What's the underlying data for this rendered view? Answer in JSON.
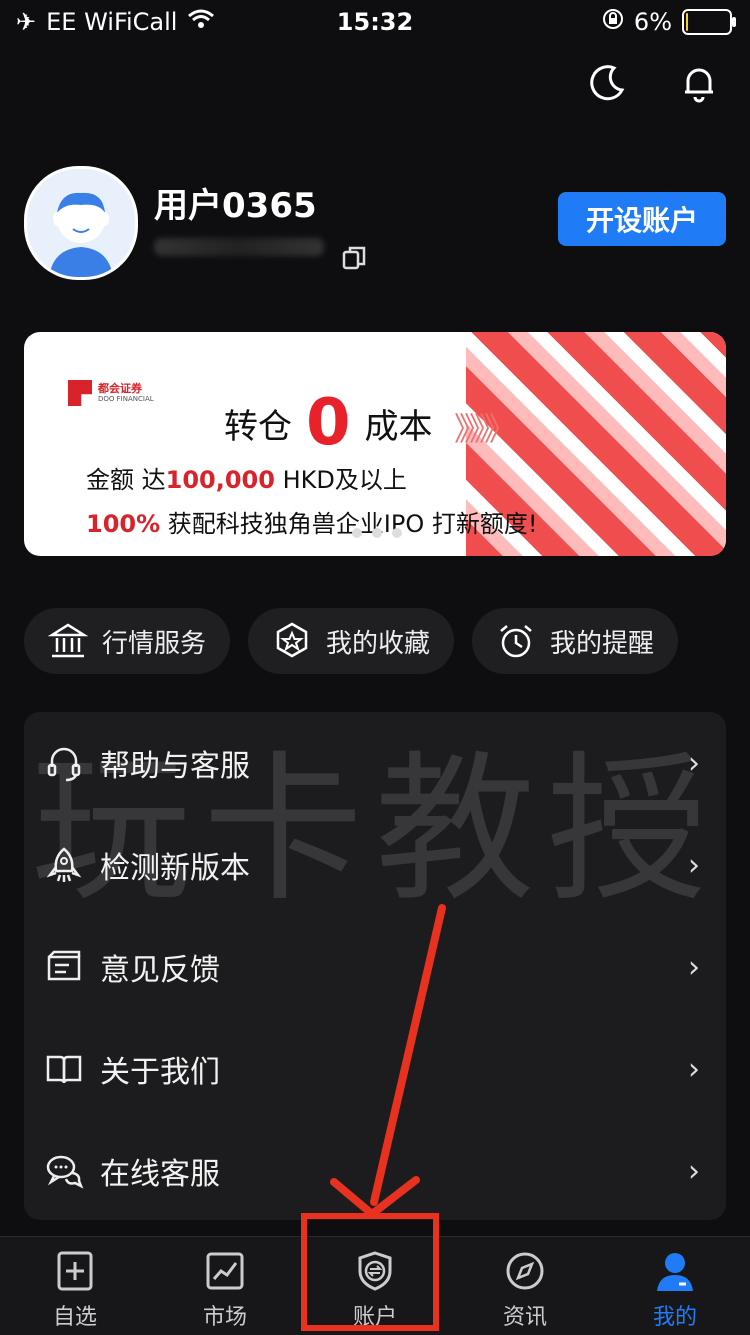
{
  "status_bar": {
    "carrier": "EE WiFiCall",
    "time": "15:32",
    "battery": "6%",
    "battery_level": 0.06
  },
  "profile": {
    "username": "用户0365",
    "open_account": "开设账户"
  },
  "banner": {
    "brand": "都会证券",
    "brand_sub": "DOO FINANCIAL",
    "title_prefix": "转仓",
    "title_zero": "0",
    "title_suffix": "成本",
    "chevrons": "》》》》",
    "line1_a": "金额 达",
    "line1_b": "100,000",
    "line1_c": " HKD及以上",
    "line2_a": "100%",
    "line2_b": " 获配科技独角兽企业IPO 打新额度!"
  },
  "quick_chips": [
    {
      "label": "行情服务",
      "icon": "bank-icon"
    },
    {
      "label": "我的收藏",
      "icon": "award-icon"
    },
    {
      "label": "我的提醒",
      "icon": "alarm-clock-icon"
    }
  ],
  "menu": [
    {
      "label": "帮助与客服",
      "icon": "headset-icon"
    },
    {
      "label": "检测新版本",
      "icon": "rocket-icon"
    },
    {
      "label": "意见反馈",
      "icon": "feedback-icon"
    },
    {
      "label": "关于我们",
      "icon": "book-icon"
    },
    {
      "label": "在线客服",
      "icon": "chat-bubbles-icon"
    }
  ],
  "watermark": "玩卡教授",
  "tabs": [
    {
      "label": "自选",
      "icon": "add-square-icon"
    },
    {
      "label": "市场",
      "icon": "chart-line-icon"
    },
    {
      "label": "账户",
      "icon": "shield-transfer-icon"
    },
    {
      "label": "资讯",
      "icon": "compass-icon"
    },
    {
      "label": "我的",
      "icon": "user-icon"
    }
  ],
  "colors": {
    "accent": "#1f7cf6",
    "annotation": "#e8321f",
    "banner_red": "#d8232a"
  }
}
